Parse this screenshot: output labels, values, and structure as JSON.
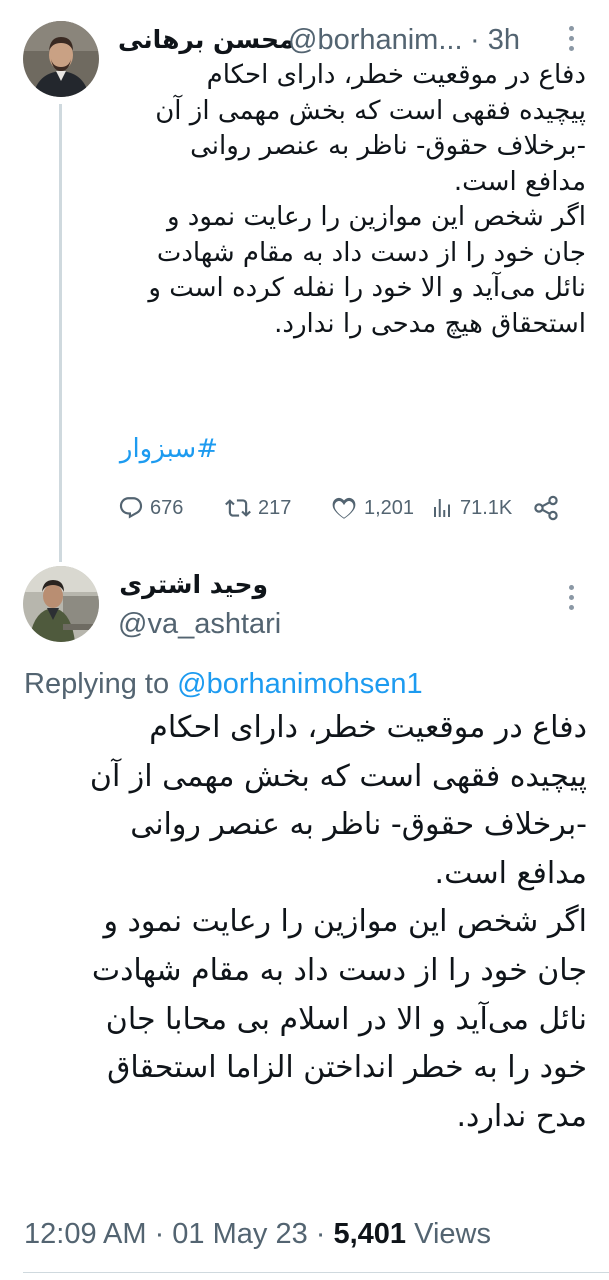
{
  "parent_tweet": {
    "author_name": "محسن برهانی",
    "handle": "@borhanim...",
    "time": "· 3h",
    "body": "دفاع در موقعیت خطر، دارای احکام\nپیچیده فقهی است که بخش مهمی از آن\n-برخلاف حقوق- ناظر به عنصر روانی\nمدافع است.\nاگر شخص این موازین را رعایت نمود و\nجان خود را از دست داد به مقام شهادت\nنائل می‌آید و الا خود را نفله کرده است و\nاستحقاق هیچ مدحی را ندارد.",
    "hashtag": "#سبزوار",
    "stats": {
      "replies": "676",
      "retweets": "217",
      "likes": "1,201",
      "views": "71.1K"
    }
  },
  "reply_tweet": {
    "author_name": "وحید اشتری",
    "handle": "@va_ashtari",
    "replying_to_label": "Replying to",
    "replying_to_handle": "@borhanimohsen1",
    "body": "دفاع در موقعیت خطر، دارای احکام\nپیچیده فقهی است که بخش مهمی از آن\n-برخلاف حقوق- ناظر به عنصر روانی\nمدافع است.\nاگر شخص این موازین را رعایت نمود و\nجان خود را از دست داد به مقام شهادت\nنائل می‌آید و الا در اسلام بی محابا جان\nخود را به خطر انداختن الزاما استحقاق\nمدح ندارد.",
    "timestamp": "12:09 AM · 01 May 23 · ",
    "views_count": "5,401",
    "views_label": " Views"
  },
  "colors": {
    "text": "#0f1419",
    "secondary": "#536471",
    "accent": "#1d9bf0",
    "divider": "#cfd9de"
  },
  "icons": [
    "reply-icon",
    "retweet-icon",
    "like-icon",
    "views-icon",
    "share-icon",
    "more-icon"
  ]
}
